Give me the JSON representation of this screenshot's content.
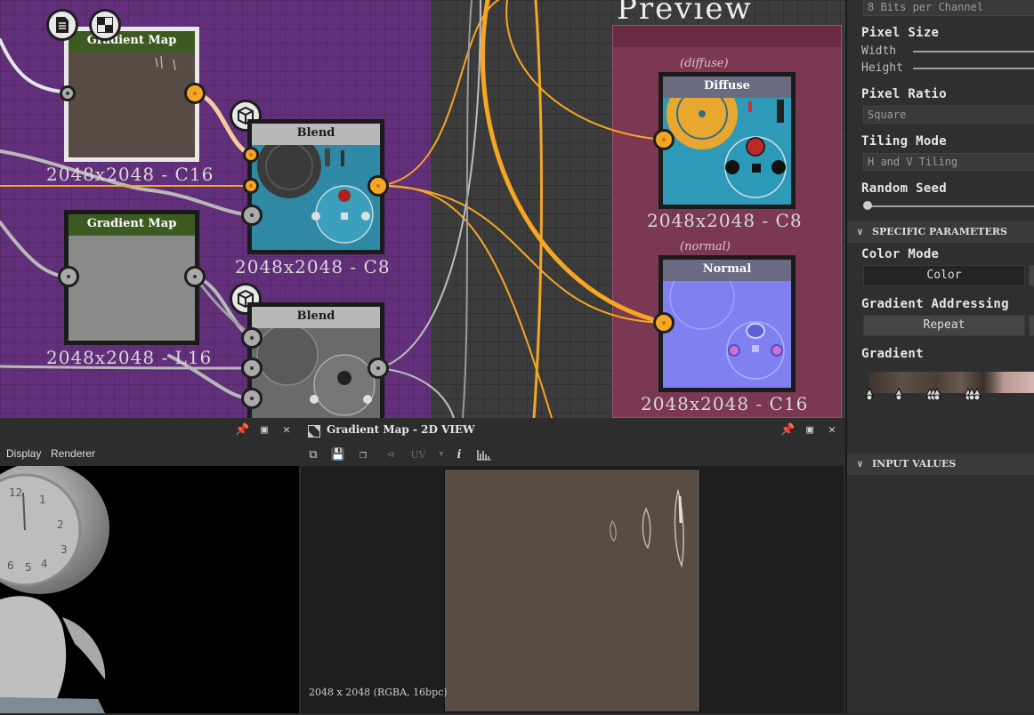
{
  "graph": {
    "preview_frame_title": "Preview",
    "nodes": {
      "gm1": {
        "title": "Gradient Map",
        "resolution": "2048x2048 - C16"
      },
      "gm2": {
        "title": "Gradient Map",
        "resolution": "2048x2048 - L16"
      },
      "blend1": {
        "title": "Blend",
        "resolution": "2048x2048 - C8"
      },
      "blend2": {
        "title": "Blend"
      },
      "diffuse": {
        "title": "Diffuse",
        "comment": "(diffuse)",
        "resolution": "2048x2048 - C8"
      },
      "normal": {
        "title": "Normal",
        "comment": "(normal)",
        "resolution": "2048x2048 - C16"
      }
    }
  },
  "view3d": {
    "menu": [
      "Display",
      "Renderer"
    ]
  },
  "view2d": {
    "title": "Gradient Map - 2D VIEW",
    "uv_label": "UV",
    "status": "2048 x 2048 (RGBA, 16bpc)"
  },
  "props": {
    "bits_field": "8 Bits per Channel",
    "pixel_size": {
      "label": "Pixel Size",
      "width": "Width",
      "height": "Height"
    },
    "pixel_ratio": {
      "label": "Pixel Ratio",
      "value": "Square"
    },
    "tiling_mode": {
      "label": "Tiling Mode",
      "value": "H and V Tiling"
    },
    "random_seed": {
      "label": "Random Seed"
    },
    "specific_section": "SPECIFIC PARAMETERS",
    "color_mode": {
      "label": "Color Mode",
      "value": "Color"
    },
    "gradient_addressing": {
      "label": "Gradient Addressing",
      "value": "Repeat"
    },
    "gradient": {
      "label": "Gradient"
    },
    "input_section": "INPUT VALUES"
  },
  "colors": {
    "frame_purple": "#62307a",
    "frame_preview": "#7a3852",
    "wire_orange": "#f5a623",
    "gm_header": "#3d5a22",
    "blend_header": "#b8b8b8"
  }
}
